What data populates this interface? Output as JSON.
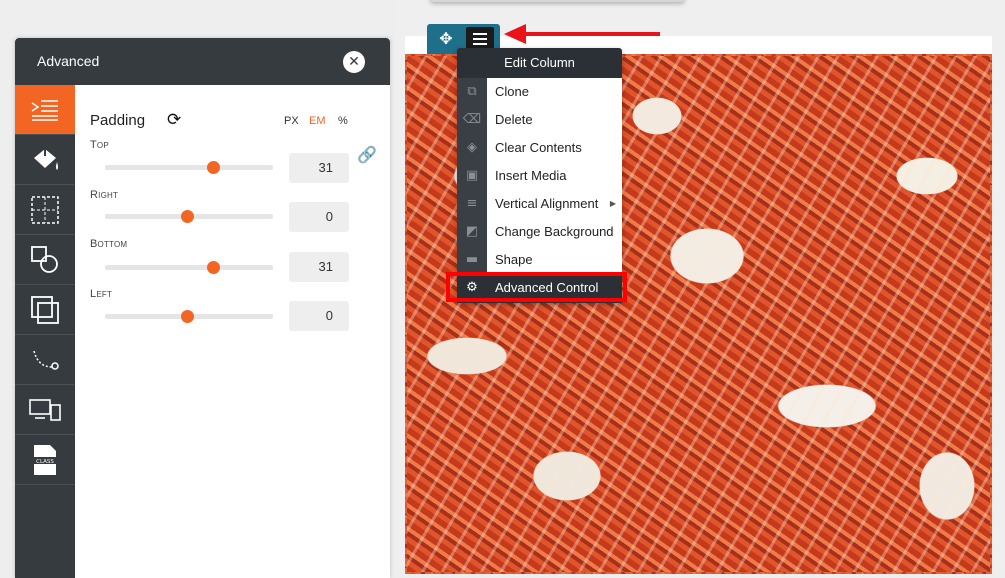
{
  "panel": {
    "title": "Advanced",
    "close_glyph": "✕",
    "sidebar": [
      {
        "icon": "list-lines-icon",
        "active": true
      },
      {
        "icon": "paint-bucket-icon",
        "active": false
      },
      {
        "icon": "dashed-box-icon",
        "active": false
      },
      {
        "icon": "shapes-icon",
        "active": false
      },
      {
        "icon": "layers-icon",
        "active": false
      },
      {
        "icon": "motion-path-icon",
        "active": false
      },
      {
        "icon": "responsive-devices-icon",
        "active": false
      },
      {
        "icon": "class-file-icon",
        "active": false
      }
    ],
    "padding": {
      "title": "Padding",
      "reset_glyph": "⟳",
      "units": [
        "PX",
        "EM",
        "%"
      ],
      "active_unit": "EM",
      "link_glyph": "🔗",
      "sides": [
        {
          "label": "Top",
          "value": "31",
          "slider_fraction": 0.64
        },
        {
          "label": "Right",
          "value": "0",
          "slider_fraction": 0.49
        },
        {
          "label": "Bottom",
          "value": "31",
          "slider_fraction": 0.64
        },
        {
          "label": "Left",
          "value": "0",
          "slider_fraction": 0.49
        }
      ]
    }
  },
  "toolbar": {
    "move_glyph": "✥"
  },
  "dropdown": {
    "title": "Edit Column",
    "items": [
      {
        "label": "Clone",
        "icon": "clone-icon",
        "glyph": "⧉"
      },
      {
        "label": "Delete",
        "icon": "delete-icon",
        "glyph": "⌫"
      },
      {
        "label": "Clear Contents",
        "icon": "eraser-icon",
        "glyph": "◈"
      },
      {
        "label": "Insert Media",
        "icon": "media-icon",
        "glyph": "▣"
      },
      {
        "label": "Vertical Alignment",
        "icon": "align-icon",
        "glyph": "≡",
        "has_submenu": true,
        "submenu_glyph": "▶"
      },
      {
        "label": "Change Background",
        "icon": "background-icon",
        "glyph": "◩"
      },
      {
        "label": "Shape",
        "icon": "shape-icon",
        "glyph": "▬"
      },
      {
        "label": "Advanced Control",
        "icon": "gear-icon",
        "glyph": "⚙",
        "highlighted": true
      }
    ]
  },
  "colors": {
    "accent": "#f26522",
    "panel_dark": "#363b40",
    "toolbar_blue": "#1f6f8b",
    "annotation_red": "#e8141a"
  }
}
